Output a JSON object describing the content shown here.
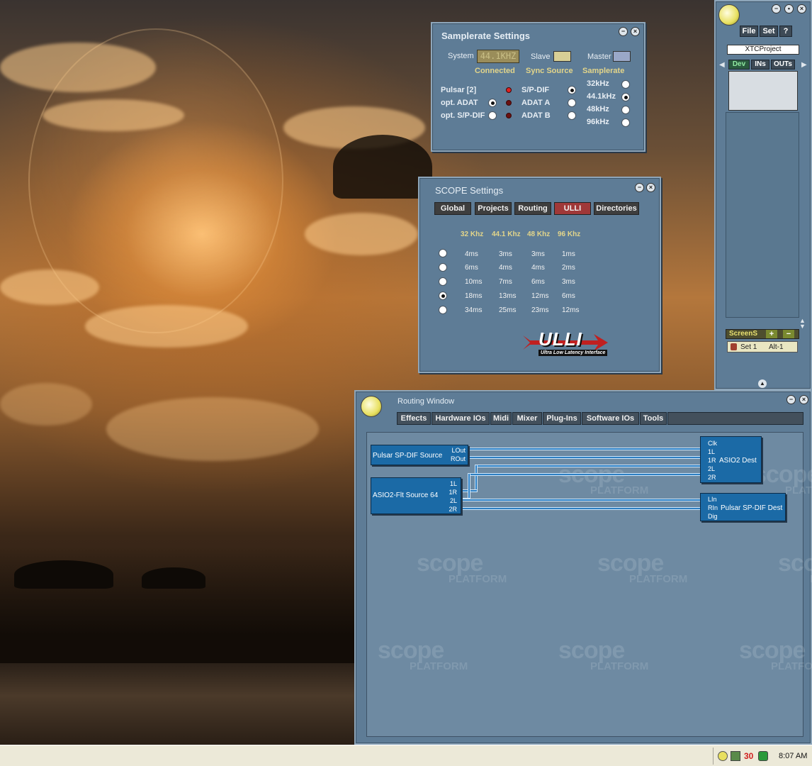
{
  "samplerate": {
    "title": "Samplerate Settings",
    "system_label": "System",
    "system_value": "44.1KHZ",
    "slave_label": "Slave",
    "master_label": "Master",
    "slave_color": "#d8cf96",
    "master_color": "#9aa8c8",
    "col_connected": "Connected",
    "col_sync": "Sync Source",
    "col_samplerate": "Samplerate",
    "connections": [
      {
        "label": "Pulsar [2]",
        "radio": false,
        "led_on": true
      },
      {
        "label": "opt. ADAT",
        "radio": true,
        "led_on": false
      },
      {
        "label": "opt. S/P-DIF",
        "radio": true,
        "led_on": false
      }
    ],
    "sync_sources": [
      "S/P-DIF",
      "ADAT A",
      "ADAT B"
    ],
    "rates": [
      "32kHz",
      "44.1kHz",
      "48kHz",
      "96kHz"
    ]
  },
  "scope": {
    "title": "SCOPE Settings",
    "tabs": [
      "Global",
      "Projects",
      "Routing",
      "ULLI",
      "Directories"
    ],
    "selected_tab": "ULLI",
    "columns": [
      "32 Khz",
      "44.1 Khz",
      "48 Khz",
      "96 Khz"
    ],
    "rows": [
      [
        "4ms",
        "3ms",
        "3ms",
        "1ms"
      ],
      [
        "6ms",
        "4ms",
        "4ms",
        "2ms"
      ],
      [
        "10ms",
        "7ms",
        "6ms",
        "3ms"
      ],
      [
        "18ms",
        "13ms",
        "12ms",
        "6ms"
      ],
      [
        "34ms",
        "25ms",
        "23ms",
        "12ms"
      ]
    ],
    "selected_row": 3,
    "logo_text": "ULLI",
    "logo_sub": "Ultra Low Latency Interface"
  },
  "project": {
    "menu": [
      "File",
      "Set",
      "?"
    ],
    "project_name": "XTCProject",
    "tabs": [
      "Dev",
      "INs",
      "OUTs"
    ],
    "screenset_label": "ScreenS",
    "set_name": "Set 1",
    "set_key": "Alt-1"
  },
  "routing": {
    "title": "Routing Window",
    "menu": [
      "Effects",
      "Hardware IOs",
      "Midi",
      "Mixer",
      "Plug-Ins",
      "Software IOs",
      "Tools"
    ],
    "watermark_big": "scope",
    "watermark_small": "PLATFORM",
    "modules": {
      "spdif_source": {
        "name": "Pulsar SP-DIF Source",
        "ports": [
          "LOut",
          "ROut"
        ]
      },
      "asio_source": {
        "name": "ASIO2-Flt Source 64",
        "ports": [
          "1L",
          "1R",
          "2L",
          "2R"
        ]
      },
      "asio_dest": {
        "name": "ASIO2 Dest",
        "ports": [
          "Clk",
          "1L",
          "1R",
          "2L",
          "2R"
        ]
      },
      "spdif_dest": {
        "name": "Pulsar SP-DIF Dest",
        "ports": [
          "LIn",
          "RIn",
          "Dig"
        ]
      }
    }
  },
  "taskbar": {
    "tray_count": "30",
    "clock": "8:07 AM"
  }
}
